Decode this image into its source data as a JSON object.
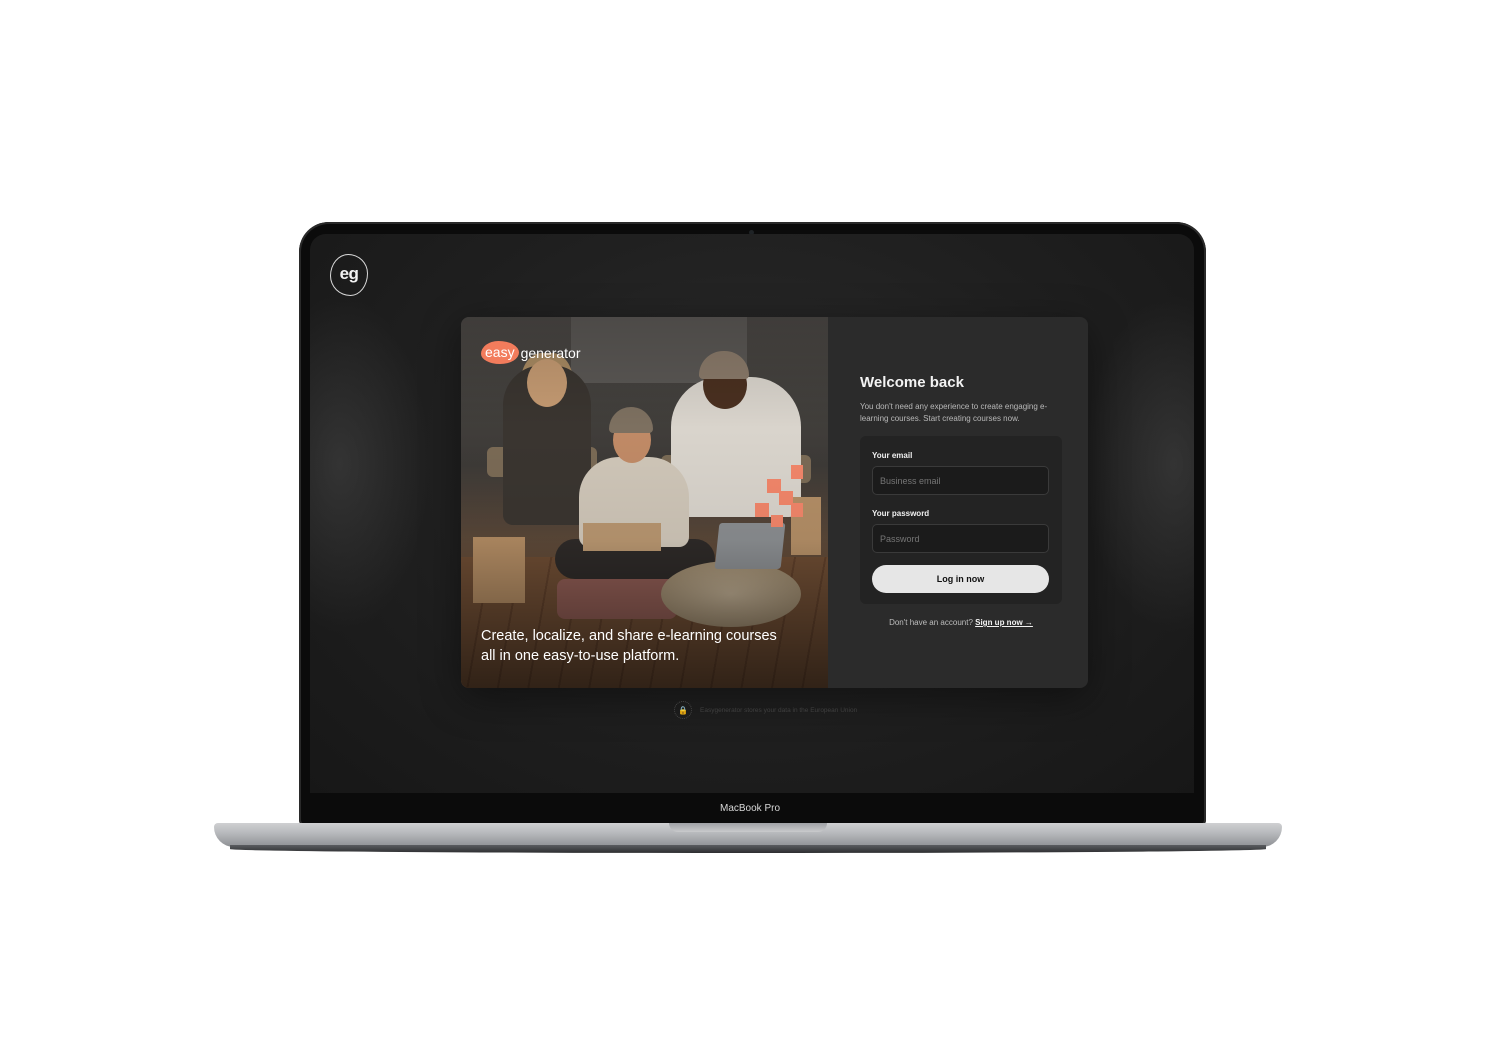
{
  "device": {
    "model_label": "MacBook Pro"
  },
  "app": {
    "logo_text": "eg"
  },
  "hero": {
    "brand_word_1": "easy",
    "brand_word_2": "generator",
    "tagline": "Create, localize, and share e-learning courses all in one easy-to-use platform."
  },
  "login": {
    "title": "Welcome back",
    "subtitle": "You don't need any experience to create engaging e-learning courses. Start creating courses now.",
    "email_label": "Your email",
    "email_placeholder": "Business email",
    "password_label": "Your password",
    "password_placeholder": "Password",
    "submit_label": "Log in now",
    "signup_prompt": "Don't have an account?",
    "signup_link": "Sign up now →"
  },
  "footer": {
    "eu_notice": "Easygenerator stores your data in the European Union"
  },
  "colors": {
    "accent": "#f27c5c",
    "background": "#1f1f1f",
    "card": "#2b2b2b",
    "button": "#e6e6e6"
  },
  "icons": {
    "logo": "eg-logo-icon",
    "eu": "lock-globe-icon"
  }
}
